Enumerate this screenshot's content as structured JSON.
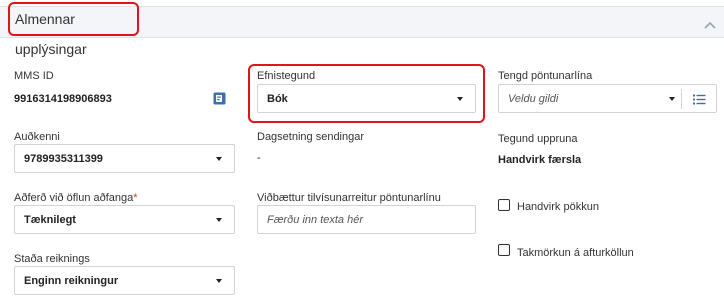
{
  "section": {
    "title": "Almennar upplýsingar"
  },
  "fields": {
    "mms_id": {
      "label": "MMS ID",
      "value": "9916314198906893"
    },
    "efnistegund": {
      "label": "Efnistegund",
      "value": "Bók"
    },
    "tengd_pontunarlina": {
      "label": "Tengd pöntunarlína",
      "placeholder": "Veldu gildi"
    },
    "audkenni": {
      "label": "Auðkenni",
      "value": "9789935311399"
    },
    "dagsetning_sendingar": {
      "label": "Dagsetning sendingar",
      "value": "-"
    },
    "tegund_uppruna": {
      "label": "Tegund uppruna",
      "value": "Handvirk færsla"
    },
    "adferd": {
      "label": "Aðferð við öflun aðfanga",
      "required_mark": "*",
      "value": "Tæknilegt"
    },
    "vidbaettur": {
      "label": "Viðbættur tilvísunarreitur pöntunarlínu",
      "placeholder": "Færðu inn texta hér"
    },
    "handvirk_pokkun": {
      "label": "Handvirk pökkun",
      "checked": false
    },
    "takmorkun": {
      "label": "Takmörkun á afturköllun",
      "checked": false
    },
    "stada_reiknings": {
      "label": "Staða reiknings",
      "value": "Enginn reikningur"
    }
  },
  "icons": {
    "collapse": "chevron-up-icon",
    "mms_action": "open-record-icon",
    "list": "list-icon"
  },
  "colors": {
    "highlight": "#e0141e",
    "accent": "#3d6fa8",
    "header_bg": "#f3f5f8"
  }
}
